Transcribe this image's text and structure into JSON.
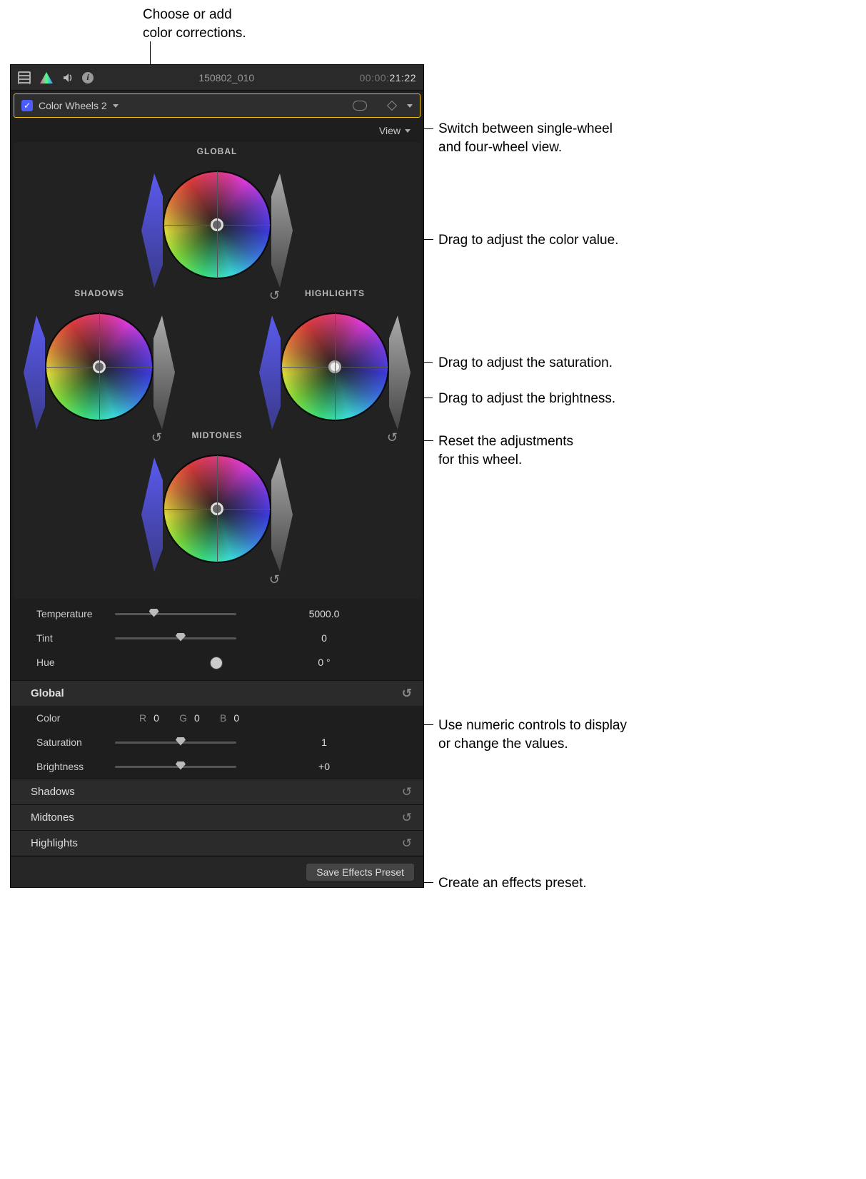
{
  "annotations": {
    "choose": "Choose or add\ncolor corrections.",
    "view": "Switch between single-wheel\nand four-wheel view.",
    "colorValue": "Drag to adjust the color value.",
    "saturation": "Drag to adjust the saturation.",
    "brightness": "Drag to adjust the brightness.",
    "reset": "Reset the adjustments\nfor this wheel.",
    "numeric": "Use numeric controls to display\nor change the values.",
    "preset": "Create an effects preset."
  },
  "toolbar": {
    "clipName": "150802_010",
    "timecodeDim": "00:00:",
    "timecodeBright": "21:22"
  },
  "correction": {
    "name": "Color Wheels 2"
  },
  "viewMenu": {
    "label": "View"
  },
  "wheels": {
    "global": "GLOBAL",
    "shadows": "SHADOWS",
    "highlights": "HIGHLIGHTS",
    "midtones": "MIDTONES"
  },
  "sliders": {
    "temperature": {
      "label": "Temperature",
      "value": "5000.0",
      "pos": 28
    },
    "tint": {
      "label": "Tint",
      "value": "0",
      "pos": 50
    },
    "hue": {
      "label": "Hue",
      "value": "0 °",
      "pos": 78
    }
  },
  "globalSection": {
    "header": "Global",
    "color": {
      "label": "Color",
      "r": "0",
      "g": "0",
      "b": "0",
      "rL": "R",
      "gL": "G",
      "bL": "B"
    },
    "saturation": {
      "label": "Saturation",
      "value": "1",
      "pos": 50
    },
    "brightness": {
      "label": "Brightness",
      "value": "+0",
      "pos": 50
    }
  },
  "sections": {
    "shadows": "Shadows",
    "midtones": "Midtones",
    "highlights": "Highlights"
  },
  "footer": {
    "savePreset": "Save Effects Preset"
  }
}
